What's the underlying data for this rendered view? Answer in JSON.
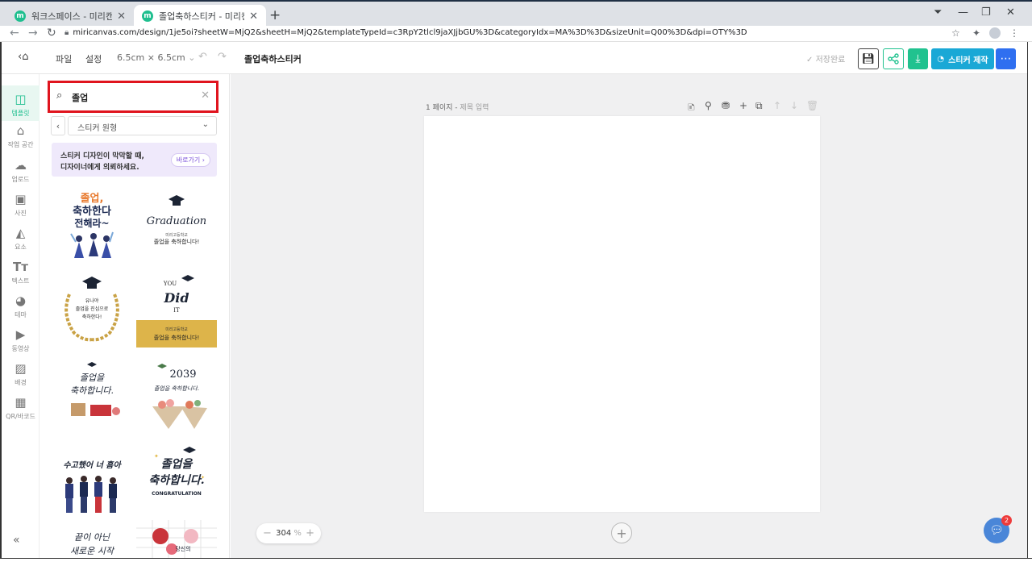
{
  "browser": {
    "tabs": [
      {
        "label": "워크스페이스 - 미리캔버스",
        "active": false
      },
      {
        "label": "졸업축하스티커 - 미리캔버스",
        "active": true
      }
    ],
    "favicon_letter": "m",
    "url": "miricanvas.com/design/1je5oi?sheetW=MjQ2&sheetH=MjQ2&templateTypeId=c3RpY2tlcl9jaXJjbGU%3D&categoryIdx=MA%3D%3D&sizeUnit=Q00%3D&dpi=OTY%3D"
  },
  "header": {
    "menu_file": "파일",
    "menu_settings": "설정",
    "size": "6.5cm × 6.5cm",
    "doc_title": "졸업축하스티커",
    "save_status": "저장완료",
    "make_button": "스티커 제작"
  },
  "rail": {
    "items": [
      {
        "label": "템플릿",
        "icon": "template-icon"
      },
      {
        "label": "작업 공간",
        "icon": "workspace-icon"
      },
      {
        "label": "업로드",
        "icon": "upload-icon"
      },
      {
        "label": "사진",
        "icon": "photo-icon"
      },
      {
        "label": "요소",
        "icon": "elements-icon"
      },
      {
        "label": "텍스트",
        "icon": "text-icon"
      },
      {
        "label": "테마",
        "icon": "theme-icon"
      },
      {
        "label": "동영상",
        "icon": "video-icon"
      },
      {
        "label": "배경",
        "icon": "background-icon"
      },
      {
        "label": "QR/바코드",
        "icon": "qr-icon"
      }
    ]
  },
  "panel": {
    "search_value": "졸업",
    "category": "스티커 원형",
    "promo_line1": "스티커 디자인이 막막할 때,",
    "promo_line2": "디자이너에게 의뢰하세요.",
    "promo_button": "바로가기",
    "templates": [
      {
        "lines": [
          "졸업,",
          "축하한다",
          "전해라~"
        ]
      },
      {
        "lines": [
          "Graduation",
          "미리고등학교",
          "졸업을 축하합니다!"
        ]
      },
      {
        "lines": [
          "유나야",
          "졸업을 진심으로",
          "축하한다!"
        ]
      },
      {
        "lines": [
          "YOU",
          "Did",
          "IT",
          "미리고등학교",
          "졸업을 축하합니다!"
        ]
      },
      {
        "lines": [
          "졸업을",
          "축하합니다."
        ]
      },
      {
        "lines": [
          "2039",
          "졸업을 축하합니다."
        ]
      },
      {
        "lines": [
          "수고했어 너 흠아"
        ]
      },
      {
        "lines": [
          "졸업을",
          "축하합니다.",
          "CONGRATULATION"
        ]
      },
      {
        "lines": [
          "끝이 아닌",
          "새로운 시작"
        ]
      },
      {
        "lines": [
          "당신의"
        ]
      }
    ]
  },
  "canvas": {
    "page_label": "1 페이지",
    "page_title_placeholder": "제목 입력",
    "zoom": "304",
    "zoom_unit": "%"
  },
  "chat_badge": "2",
  "colors": {
    "accent_green": "#21c28f",
    "make_blue": "#1aa8d6",
    "more_blue": "#2f6ff0",
    "search_highlight": "#e0141e",
    "promo_bg": "#efe9fb"
  }
}
